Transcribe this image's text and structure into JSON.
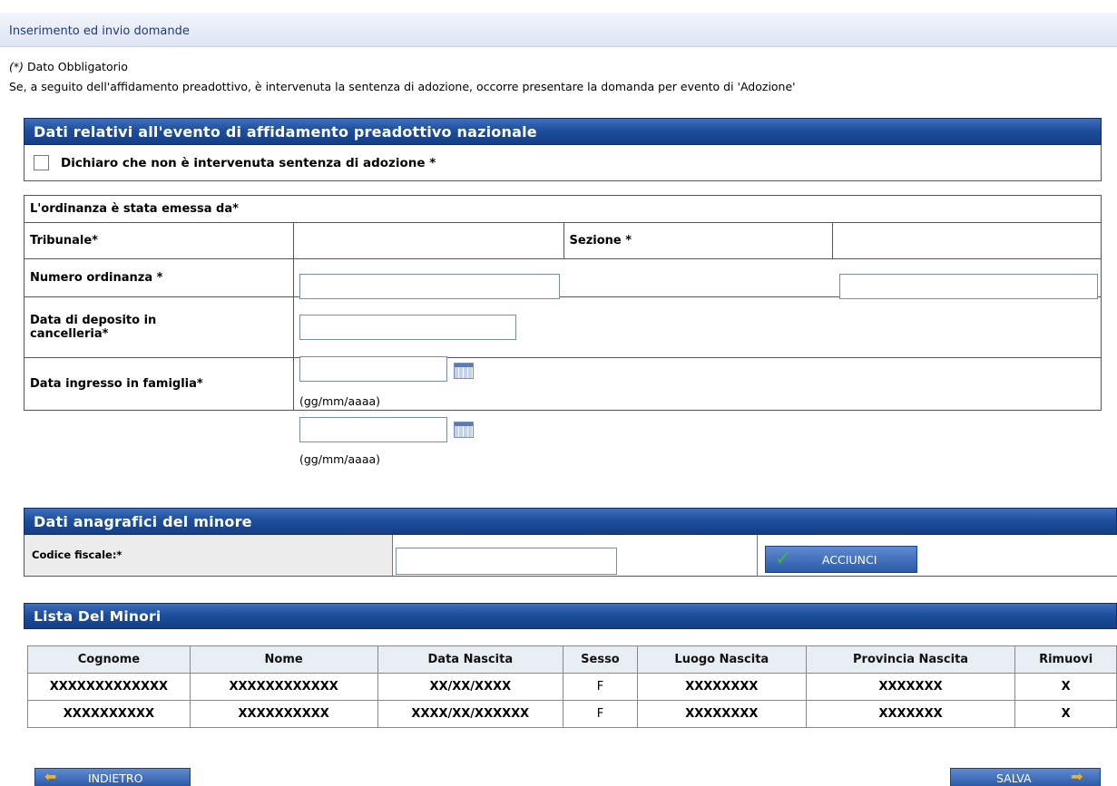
{
  "topbar": {
    "title": "Inserimento ed invio domande"
  },
  "notes": {
    "mandatory_star": "(*)",
    "mandatory_text": " Dato Obbligatorio",
    "adoption_note": "Se, a seguito dell'affidamento preadottivo, è intervenuta la sentenza di adozione, occorre presentare la domanda per evento di 'Adozione'"
  },
  "event_section": {
    "title": "Dati relativi all'evento di affidamento preadottivo nazionale",
    "declaration_checked": false,
    "declaration_label": "Dichiaro che non è intervenuta sentenza di adozione *"
  },
  "ordinance": {
    "header": "L'ordinanza è stata emessa da*",
    "tribunale_label": "Tribunale*",
    "tribunale_value": "",
    "sezione_label": "Sezione  *",
    "sezione_value": "",
    "numero_label": "Numero ordinanza *",
    "numero_value": "",
    "deposito_label": "Data di deposito in cancelleria*",
    "deposito_value": "",
    "ingresso_label": "Data ingresso in famiglia*",
    "ingresso_value": "",
    "date_hint": "(gg/mm/aaaa)"
  },
  "minore_section": {
    "title": "Dati anagrafici del minore",
    "codice_label": "Codice fiscale:*",
    "codice_value": "",
    "add_button": "ACCIUNCI"
  },
  "list_section": {
    "title": "Lista Del Minori",
    "columns": [
      "Cognome",
      "Nome",
      "Data Nascita",
      "Sesso",
      "Luogo Nascita",
      "Provincia Nascita",
      "Rimuovi"
    ],
    "rows": [
      [
        "XXXXXXXXXXXXX",
        "XXXXXXXXXXXX",
        "XX/XX/XXXX",
        "F",
        "XXXXXXXX",
        "XXXXXXX",
        "X"
      ],
      [
        "XXXXXXXXXX",
        "XXXXXXXXXX",
        "XXXX/XX/XXXXXX",
        "F",
        "XXXXXXXX",
        "XXXXXXX",
        "X"
      ]
    ]
  },
  "nav": {
    "back_label": "INDIETRO",
    "save_label": "SALVA"
  },
  "colors": {
    "header_blue": "#1d4f9e",
    "accent_orange": "#f5b21c",
    "check_green": "#3cb83a"
  }
}
